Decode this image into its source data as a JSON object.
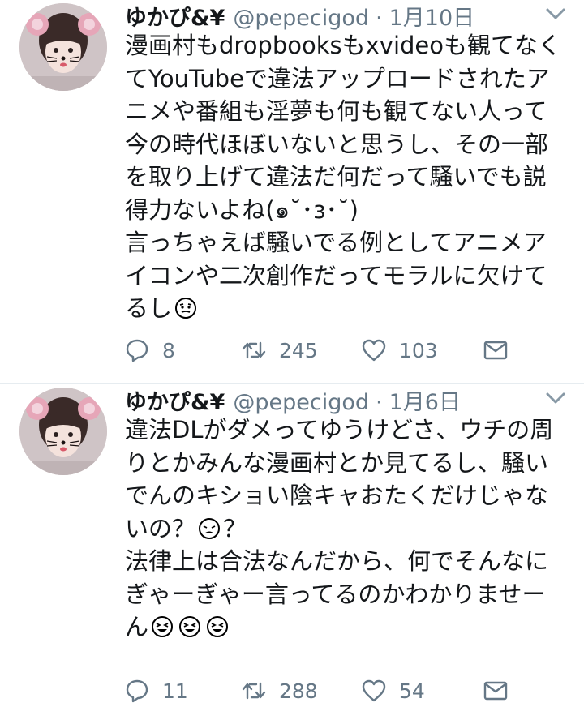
{
  "tweets": [
    {
      "display_name": "ゆかぴ&¥",
      "handle": "@pepecigod",
      "separator": "·",
      "date": "1月10日",
      "lines": [
        "漫画村もdropbooksもxvideoも観てなく",
        "てYouTubeで違法アップロードされたア",
        "ニメや番組も淫夢も何も観てない人って",
        "今の時代ほぼいないと思うし、その一部",
        "を取り上げて違法だ何だって騒いでも説",
        "得力ないよね(๑˘･з･˘)",
        "言っちゃえば騒いでる例としてアニメア",
        "イコンや二次創作だってモラルに欠けて",
        "るし"
      ],
      "replies": "8",
      "retweets": "245",
      "likes": "103"
    },
    {
      "display_name": "ゆかぴ&¥",
      "handle": "@pepecigod",
      "separator": "·",
      "date": "1月6日",
      "lines": [
        "違法DLがダメってゆうけどさ、ウチの周",
        "りとかみんな漫画村とか見てるし、騒い",
        "でんのキショい陰キャおたくだけじゃな",
        "いの？",
        "法律上は合法なんだから、何でそんなに",
        "ぎゃーぎゃー言ってるのかわかりませー",
        "ん"
      ],
      "line4_suffix": "？",
      "replies": "11",
      "retweets": "288",
      "likes": "54"
    }
  ],
  "colors": {
    "text": "#14171a",
    "secondary": "#657786",
    "divider": "#e6ecf0",
    "emoji_outline": "#000000"
  },
  "icons": [
    "reply-icon",
    "retweet-icon",
    "like-icon",
    "direct-message-icon",
    "chevron-down-icon",
    "emoji-icon"
  ]
}
